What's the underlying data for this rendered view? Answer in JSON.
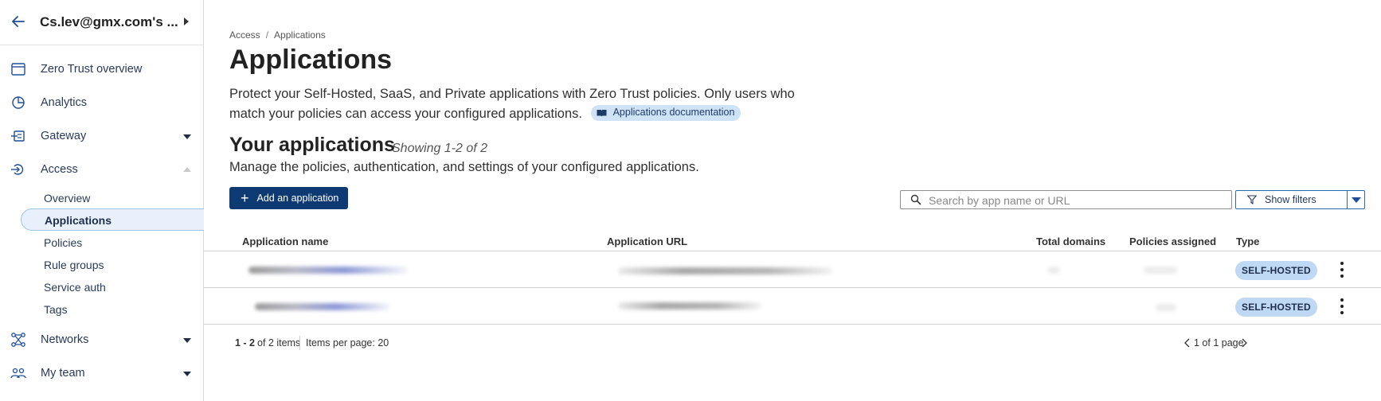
{
  "account": {
    "name": "Cs.lev@gmx.com's ..."
  },
  "sidebar": {
    "items": [
      {
        "label": "Zero Trust overview",
        "icon": "browser-window-icon"
      },
      {
        "label": "Analytics",
        "icon": "pie-chart-icon"
      },
      {
        "label": "Gateway",
        "icon": "gateway-icon",
        "expandable": true
      },
      {
        "label": "Access",
        "icon": "access-icon",
        "expanded": true,
        "children": [
          "Overview",
          "Applications",
          "Policies",
          "Rule groups",
          "Service auth",
          "Tags"
        ],
        "active_child": "Applications"
      },
      {
        "label": "Networks",
        "icon": "network-icon",
        "expandable": true
      },
      {
        "label": "My team",
        "icon": "team-icon",
        "expandable": true
      }
    ]
  },
  "breadcrumb": {
    "parent": "Access",
    "separator": "/",
    "current": "Applications"
  },
  "page": {
    "title": "Applications",
    "description": "Protect your Self-Hosted, SaaS, and Private applications with Zero Trust policies. Only users who match your policies can access your configured applications.",
    "doc_link": "Applications documentation"
  },
  "section": {
    "title": "Your applications",
    "showing": "Showing 1-2 of 2",
    "description": "Manage the policies, authentication, and settings of your configured applications."
  },
  "toolbar": {
    "add_label": "Add an application",
    "search_placeholder": "Search by app name or URL",
    "filters_label": "Show filters"
  },
  "table": {
    "columns": [
      "Application name",
      "Application URL",
      "Total domains",
      "Policies assigned",
      "Type"
    ],
    "rows": [
      {
        "type": "SELF-HOSTED"
      },
      {
        "type": "SELF-HOSTED"
      }
    ]
  },
  "pagination": {
    "range": "1 - 2",
    "of_items": "of 2 items",
    "items_per_page": "Items per page: 20",
    "pages": "1 of 1 page"
  },
  "colors": {
    "primary": "#0e3a73",
    "badge": "#bfd9f4",
    "active_nav": "#e8f1fb"
  }
}
